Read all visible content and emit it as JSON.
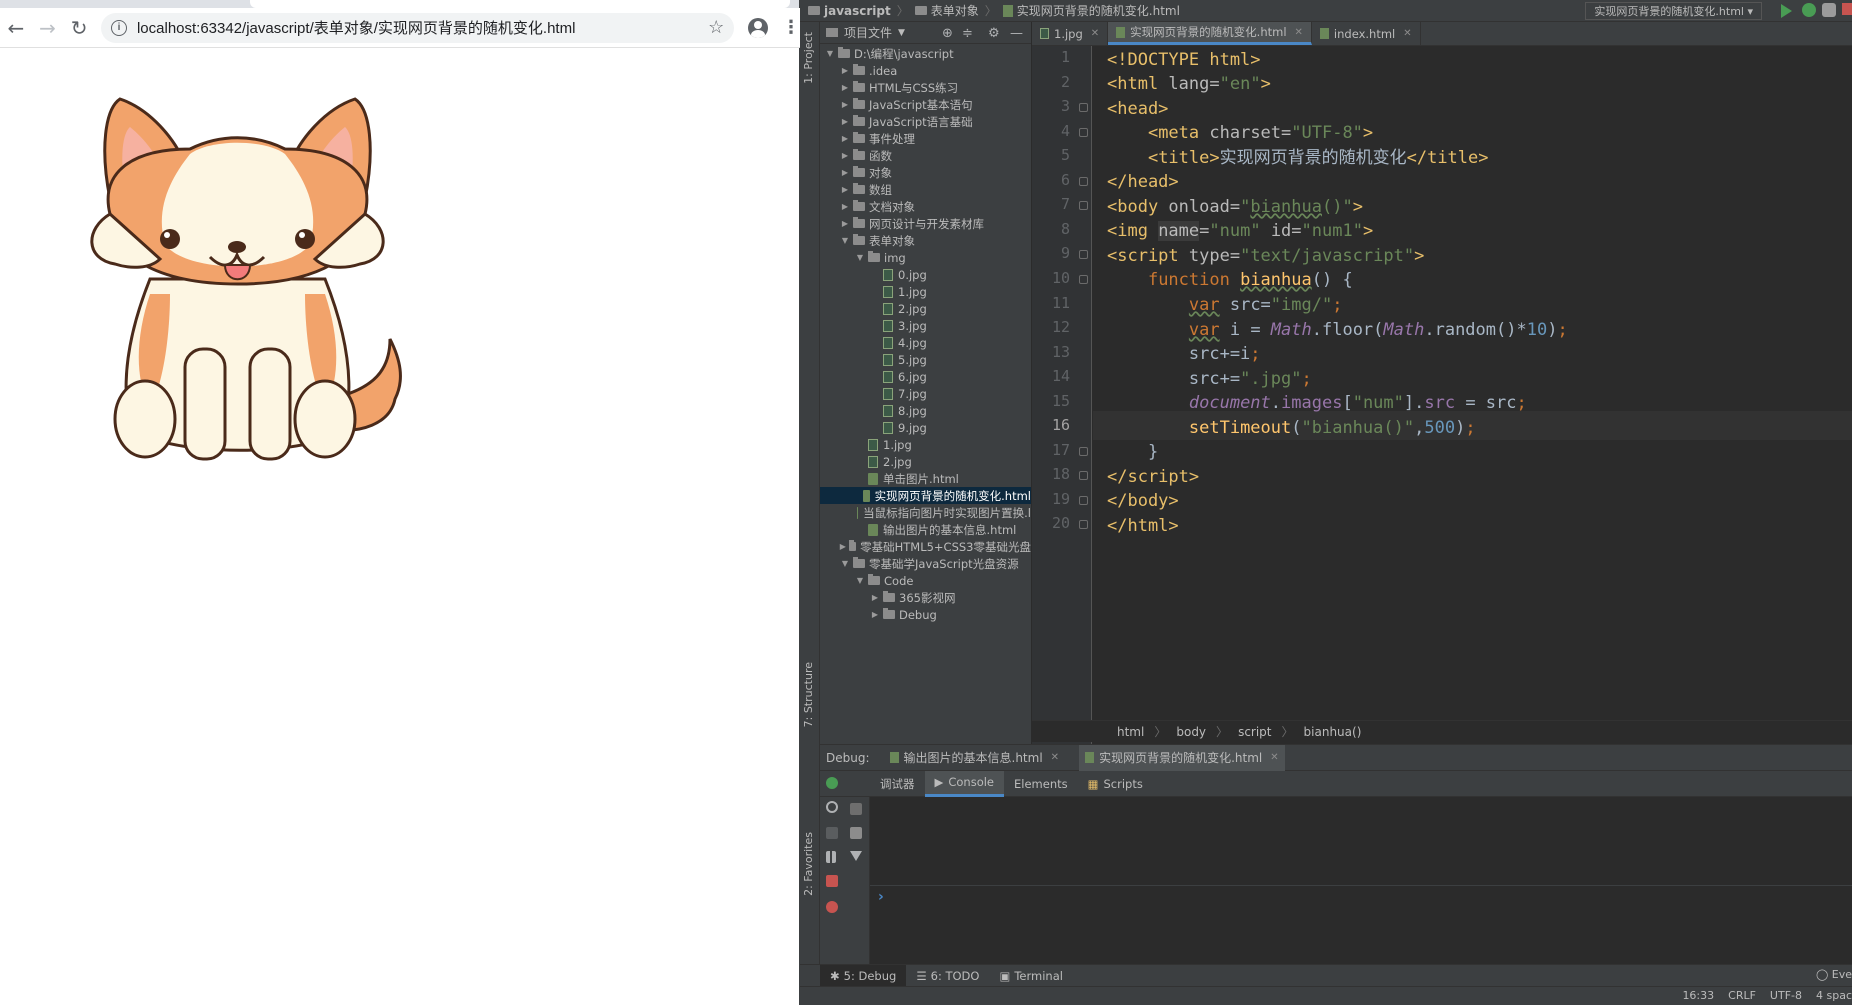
{
  "browser": {
    "url": "localhost:63342/javascript/表单对象/实现网页背景的随机变化.html",
    "back_icon": "←",
    "forward_icon": "→",
    "reload_icon": "↻",
    "star_icon": "☆",
    "menu_icon": "⋮",
    "info_icon": "i",
    "image_alt": "corgi-puppy"
  },
  "ide": {
    "nav": {
      "crumbs": [
        "javascript",
        "表单对象",
        "实现网页背景的随机变化.html"
      ],
      "run_config": "实现网页背景的随机变化.html ▾"
    },
    "left_stripe": {
      "project": "1: Project",
      "structure": "7: Structure",
      "favorites": "2: Favorites"
    },
    "project": {
      "header": "项目文件",
      "tree": [
        {
          "depth": 0,
          "arrow": "▼",
          "type": "folder",
          "label": "D:\\编程\\javascript"
        },
        {
          "depth": 1,
          "arrow": "▶",
          "type": "folder",
          "label": ".idea"
        },
        {
          "depth": 1,
          "arrow": "▶",
          "type": "folder",
          "label": "HTML与CSS练习"
        },
        {
          "depth": 1,
          "arrow": "▶",
          "type": "folder",
          "label": "JavaScript基本语句"
        },
        {
          "depth": 1,
          "arrow": "▶",
          "type": "folder",
          "label": "JavaScript语言基础"
        },
        {
          "depth": 1,
          "arrow": "▶",
          "type": "folder",
          "label": "事件处理"
        },
        {
          "depth": 1,
          "arrow": "▶",
          "type": "folder",
          "label": "函数"
        },
        {
          "depth": 1,
          "arrow": "▶",
          "type": "folder",
          "label": "对象"
        },
        {
          "depth": 1,
          "arrow": "▶",
          "type": "folder",
          "label": "数组"
        },
        {
          "depth": 1,
          "arrow": "▶",
          "type": "folder",
          "label": "文档对象"
        },
        {
          "depth": 1,
          "arrow": "▶",
          "type": "folder",
          "label": "网页设计与开发素材库"
        },
        {
          "depth": 1,
          "arrow": "▼",
          "type": "folder",
          "label": "表单对象"
        },
        {
          "depth": 2,
          "arrow": "▼",
          "type": "folder",
          "label": "img"
        },
        {
          "depth": 3,
          "arrow": "",
          "type": "jpg",
          "label": "0.jpg"
        },
        {
          "depth": 3,
          "arrow": "",
          "type": "jpg",
          "label": "1.jpg"
        },
        {
          "depth": 3,
          "arrow": "",
          "type": "jpg",
          "label": "2.jpg"
        },
        {
          "depth": 3,
          "arrow": "",
          "type": "jpg",
          "label": "3.jpg"
        },
        {
          "depth": 3,
          "arrow": "",
          "type": "jpg",
          "label": "4.jpg"
        },
        {
          "depth": 3,
          "arrow": "",
          "type": "jpg",
          "label": "5.jpg"
        },
        {
          "depth": 3,
          "arrow": "",
          "type": "jpg",
          "label": "6.jpg"
        },
        {
          "depth": 3,
          "arrow": "",
          "type": "jpg",
          "label": "7.jpg"
        },
        {
          "depth": 3,
          "arrow": "",
          "type": "jpg",
          "label": "8.jpg"
        },
        {
          "depth": 3,
          "arrow": "",
          "type": "jpg",
          "label": "9.jpg"
        },
        {
          "depth": 2,
          "arrow": "",
          "type": "jpg",
          "label": "1.jpg"
        },
        {
          "depth": 2,
          "arrow": "",
          "type": "jpg",
          "label": "2.jpg"
        },
        {
          "depth": 2,
          "arrow": "",
          "type": "html",
          "label": "单击图片.html"
        },
        {
          "depth": 2,
          "arrow": "",
          "type": "html",
          "label": "实现网页背景的随机变化.html",
          "selected": true
        },
        {
          "depth": 2,
          "arrow": "",
          "type": "html",
          "label": "当鼠标指向图片时实现图片置换.l"
        },
        {
          "depth": 2,
          "arrow": "",
          "type": "html",
          "label": "输出图片的基本信息.html"
        },
        {
          "depth": 1,
          "arrow": "▶",
          "type": "folder",
          "label": "零基础HTML5+CSS3零基础光盘"
        },
        {
          "depth": 1,
          "arrow": "▼",
          "type": "folder",
          "label": "零基础学JavaScript光盘资源"
        },
        {
          "depth": 2,
          "arrow": "▼",
          "type": "folder",
          "label": "Code"
        },
        {
          "depth": 3,
          "arrow": "▶",
          "type": "folder",
          "label": "365影视网"
        },
        {
          "depth": 3,
          "arrow": "▶",
          "type": "folder",
          "label": "Debug"
        }
      ]
    },
    "editor": {
      "tabs": [
        {
          "label": "1.jpg",
          "type": "jpg",
          "active": false
        },
        {
          "label": "实现网页背景的随机变化.html",
          "type": "html",
          "active": true
        },
        {
          "label": "index.html",
          "type": "html",
          "active": false
        }
      ],
      "line_numbers": [
        "1",
        "2",
        "3",
        "4",
        "5",
        "6",
        "7",
        "8",
        "9",
        "10",
        "11",
        "12",
        "13",
        "14",
        "15",
        "16",
        "17",
        "18",
        "19",
        "20"
      ],
      "current_line": 16,
      "breadcrumb": [
        "html",
        "body",
        "script",
        "bianhua()"
      ]
    },
    "debug": {
      "label": "Debug:",
      "tabs": [
        {
          "label": "输出图片的基本信息.html",
          "active": false
        },
        {
          "label": "实现网页背景的随机变化.html",
          "active": true
        }
      ],
      "subtabs": [
        {
          "label": "调试器",
          "active": false
        },
        {
          "label": "Console",
          "active": true
        },
        {
          "label": "Elements",
          "active": false
        },
        {
          "label": "Scripts",
          "active": false
        }
      ],
      "prompt": "›"
    },
    "bottom": {
      "items": [
        {
          "label": "5: Debug",
          "active": true
        },
        {
          "label": "6: TODO",
          "active": false
        },
        {
          "label": "Terminal",
          "active": false
        }
      ],
      "event_log": "Eve"
    },
    "status": [
      "16:33",
      "CRLF",
      "UTF-8",
      "4 spac"
    ]
  }
}
